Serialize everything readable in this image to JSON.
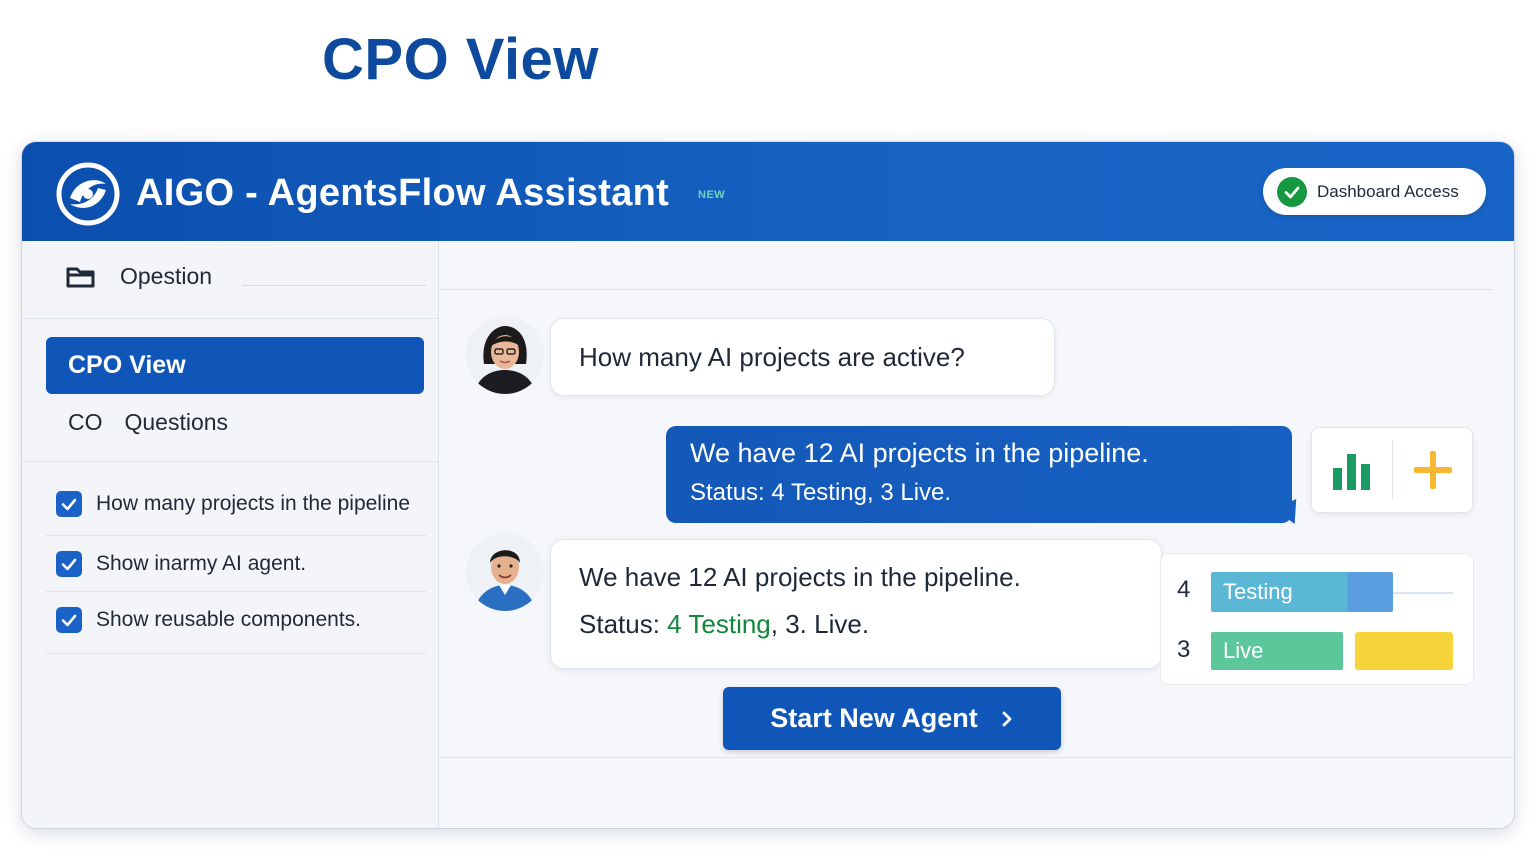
{
  "page_heading": "CPO View",
  "header": {
    "title": "AIGO - AgentsFlow Assistant",
    "badge": "NEW",
    "dashboard_button": "Dashboard Access"
  },
  "sidebar": {
    "folder_label": "Opestion",
    "nav": [
      {
        "label": "CPO View",
        "active": true
      },
      {
        "prefix": "CO",
        "label": "Questions",
        "active": false
      }
    ],
    "checklist": [
      {
        "label": "How many projects in the pipeline",
        "checked": true
      },
      {
        "label": "Show inarmy AI agent.",
        "checked": true
      },
      {
        "label": "Show reusable components.",
        "checked": true
      }
    ]
  },
  "chat": {
    "question": "How many AI projects are active?",
    "answer_line1": "We have 12 AI projects in the pipeline.",
    "answer_line2": "Status: 4 Testing, 3 Live.",
    "reply_line1": "We have 12 AI projects in the pipeline.",
    "reply_status_prefix": "Status:",
    "reply_status_highlight": "4 Testing",
    "reply_status_rest": ", 3. Live."
  },
  "status": [
    {
      "count": "4",
      "label": "Testing",
      "color": "#5ab8d6"
    },
    {
      "count": "3",
      "label": "Live",
      "color": "#5cc79b"
    }
  ],
  "tools": {
    "chart_icon": "bar-chart-icon",
    "plus_icon": "plus-icon"
  },
  "start_button": "Start New Agent",
  "colors": {
    "brand": "#0f56b8",
    "header": "#1458b8",
    "success": "#15983f",
    "highlight": "#13873b",
    "accent": "#f7b731",
    "yellow": "#f7d53a"
  }
}
